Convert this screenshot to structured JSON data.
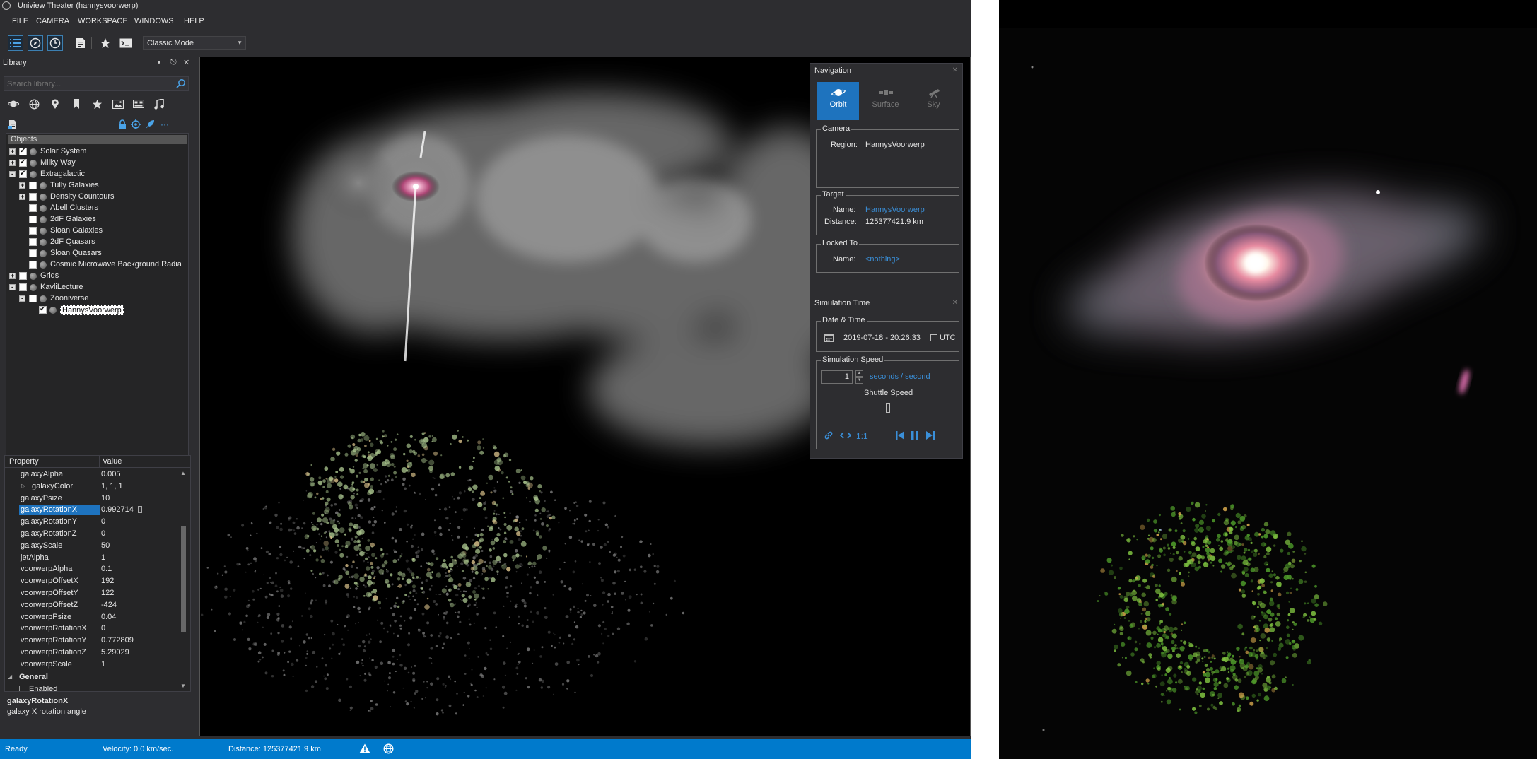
{
  "window": {
    "title": "Uniview Theater (hannysvoorwerp)"
  },
  "menu": [
    "FILE",
    "CAMERA",
    "WORKSPACE",
    "WINDOWS",
    "HELP"
  ],
  "toolbar": {
    "mode": "Classic Mode",
    "buttons": [
      "list-icon",
      "compass-icon",
      "clock-icon",
      "script-icon",
      "star-icon",
      "terminal-icon"
    ]
  },
  "library": {
    "title": "Library",
    "search_placeholder": "Search library...",
    "tree_header": "Objects",
    "items": [
      {
        "label": "Solar System",
        "level": 0,
        "expander": "+",
        "checked": true
      },
      {
        "label": "Milky Way",
        "level": 0,
        "expander": "+",
        "checked": true
      },
      {
        "label": "Extragalactic",
        "level": 0,
        "expander": "-",
        "checked": true
      },
      {
        "label": "Tully Galaxies",
        "level": 1,
        "expander": "+",
        "checked": false
      },
      {
        "label": "Density Countours",
        "level": 1,
        "expander": "+",
        "checked": false
      },
      {
        "label": "Abell Clusters",
        "level": 1,
        "expander": "",
        "checked": false
      },
      {
        "label": "2dF Galaxies",
        "level": 1,
        "expander": "",
        "checked": false
      },
      {
        "label": "Sloan Galaxies",
        "level": 1,
        "expander": "",
        "checked": false
      },
      {
        "label": "2dF Quasars",
        "level": 1,
        "expander": "",
        "checked": false
      },
      {
        "label": "Sloan Quasars",
        "level": 1,
        "expander": "",
        "checked": false
      },
      {
        "label": "Cosmic Microwave Background Radia",
        "level": 1,
        "expander": "",
        "checked": false
      },
      {
        "label": "Grids",
        "level": 0,
        "expander": "+",
        "checked": false
      },
      {
        "label": "KavliLecture",
        "level": 0,
        "expander": "-",
        "checked": false
      },
      {
        "label": "Zooniverse",
        "level": 1,
        "expander": "-",
        "checked": false
      },
      {
        "label": "HannysVoorwerp",
        "level": 2,
        "expander": "",
        "checked": true,
        "selected": true
      }
    ]
  },
  "properties": {
    "col_property": "Property",
    "col_value": "Value",
    "rows": [
      {
        "name": "galaxyAlpha",
        "value": "0.005"
      },
      {
        "name": "galaxyColor",
        "value": "1, 1, 1",
        "expandable": true
      },
      {
        "name": "galaxyPsize",
        "value": "10"
      },
      {
        "name": "galaxyRotationX",
        "value": "0.992714",
        "selected": true
      },
      {
        "name": "galaxyRotationY",
        "value": "0"
      },
      {
        "name": "galaxyRotationZ",
        "value": "0"
      },
      {
        "name": "galaxyScale",
        "value": "50"
      },
      {
        "name": "jetAlpha",
        "value": "1"
      },
      {
        "name": "voorwerpAlpha",
        "value": "0.1"
      },
      {
        "name": "voorwerpOffsetX",
        "value": "192"
      },
      {
        "name": "voorwerpOffsetY",
        "value": "122"
      },
      {
        "name": "voorwerpOffsetZ",
        "value": "-424"
      },
      {
        "name": "voorwerpPsize",
        "value": "0.04"
      },
      {
        "name": "voorwerpRotationX",
        "value": "0"
      },
      {
        "name": "voorwerpRotationY",
        "value": "0.772809"
      },
      {
        "name": "voorwerpRotationZ",
        "value": "5.29029"
      },
      {
        "name": "voorwerpScale",
        "value": "1"
      }
    ],
    "category": "General",
    "partial_row": "Enabled",
    "description_title": "galaxyRotationX",
    "description_text": "galaxy X rotation angle"
  },
  "navigation": {
    "title": "Navigation",
    "modes": [
      "Orbit",
      "Surface",
      "Sky"
    ],
    "active_mode": "Orbit",
    "camera": {
      "title": "Camera",
      "region_label": "Region:",
      "region_value": "HannysVoorwerp"
    },
    "target": {
      "title": "Target",
      "name_label": "Name:",
      "name_value": "HannysVoorwerp",
      "distance_label": "Distance:",
      "distance_value": "125377421.9 km"
    },
    "locked": {
      "title": "Locked To",
      "name_label": "Name:",
      "name_value": "<nothing>"
    }
  },
  "simulation": {
    "title": "Simulation Time",
    "date_title": "Date & Time",
    "datetime": "2019-07-18 - 20:26:33",
    "utc_label": "UTC",
    "speed_title": "Simulation Speed",
    "speed_value": "1",
    "speed_unit": "seconds / second",
    "shuttle_label": "Shuttle Speed",
    "ratio_label": "1:1",
    "shuttle_position": 0.5
  },
  "status": {
    "state": "Ready",
    "velocity": "Velocity: 0.0 km/sec.",
    "distance": "Distance: 125377421.9 km"
  },
  "colors": {
    "accent": "#007acc",
    "selection": "#1e73be",
    "link": "#3a8fd8",
    "panel": "#2d2d30"
  }
}
